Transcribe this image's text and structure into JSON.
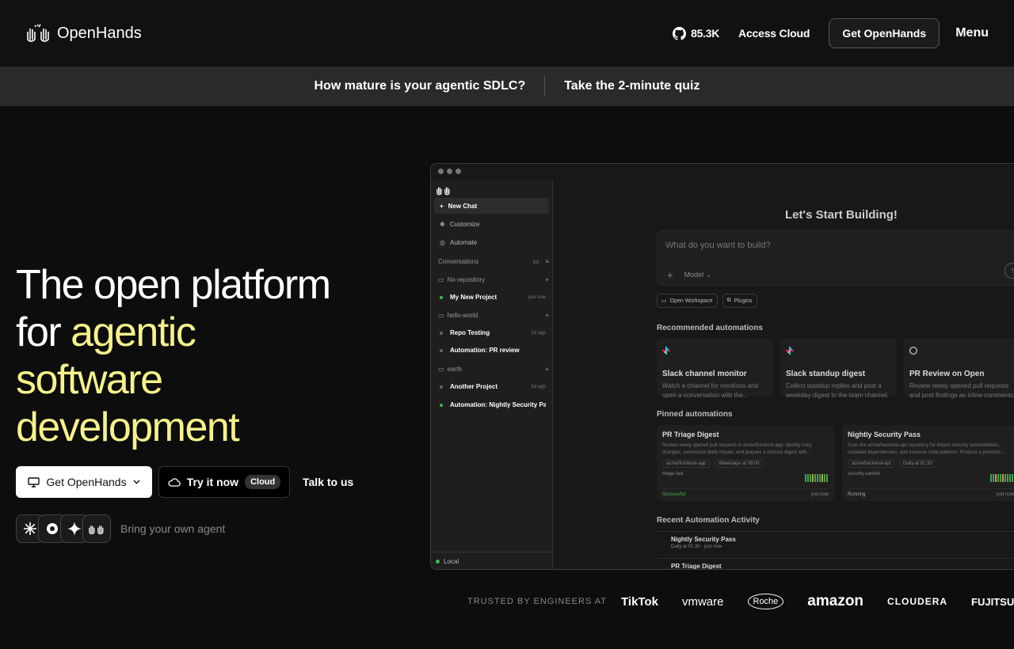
{
  "nav": {
    "brand": "OpenHands",
    "github_stars": "85.3K",
    "access_cloud": "Access Cloud",
    "get_openhands": "Get OpenHands",
    "menu": "Menu"
  },
  "banner": {
    "question": "How mature is your agentic SDLC?",
    "cta": "Take the 2-minute quiz"
  },
  "hero": {
    "title_line1": "The open platform",
    "title_for": "for ",
    "title_hl1": "agentic",
    "title_hl2": "software",
    "title_hl3": "development",
    "cta_primary": "Get OpenHands",
    "cta_secondary": "Try it now",
    "cta_secondary_badge": "Cloud",
    "cta_talk": "Talk to us",
    "byo_agent": "Bring your own agent"
  },
  "app": {
    "sidebar": {
      "new_chat": "New Chat",
      "customize": "Customize",
      "automate": "Automate",
      "conversations_label": "Conversations",
      "groups": [
        {
          "name": "No repository",
          "items": [
            {
              "title": "My New Project",
              "time": "just now",
              "dot": "#3fb950"
            }
          ]
        },
        {
          "name": "hello-world",
          "items": [
            {
              "title": "Repo Testing",
              "time": "2d ago",
              "dot": "#666"
            },
            {
              "title": "Automation: PR review",
              "time": "",
              "dot": "#666"
            }
          ]
        },
        {
          "name": "earth",
          "items": [
            {
              "title": "Another Project",
              "time": "5d ago",
              "dot": "#666"
            },
            {
              "title": "Automation: Nightly Security Pa...",
              "time": "",
              "dot": "#3fb950"
            }
          ]
        }
      ],
      "footer": "Local"
    },
    "main": {
      "title": "Let's Start Building!",
      "prompt_placeholder": "What do you want to build?",
      "model_label": "Model",
      "chip_workspace": "Open Workspace",
      "chip_plugins": "Plugins",
      "recommended_label": "Recommended automations",
      "recommended": [
        {
          "title": "Slack channel monitor",
          "desc": "Watch a channel for mentions and open a conversation with the..."
        },
        {
          "title": "Slack standup digest",
          "desc": "Collect standup replies and post a weekday digest to the team channel."
        },
        {
          "title": "PR Review on Open",
          "desc": "Review newly opened pull requests and post findings as inline comments"
        }
      ],
      "pinned_label": "Pinned automations",
      "pinned": [
        {
          "title": "PR Triage Digest",
          "desc": "Review newly opened pull requests in acme/frontend-app, identify risky changes, summarize likely impact, and prepare a concise digest with...",
          "repo": "acme/frontend-app",
          "schedule": "Weekdays at 09:00",
          "tag": "triage-fast",
          "status": "Successful",
          "status_color": "#3fb950",
          "time": "just now"
        },
        {
          "title": "Nightly Security Pass",
          "desc": "Scan the acme/backend-api repository for known security vulnerabilities, outdated dependencies, and insecure code patterns. Produce a prioritize...",
          "repo": "acme/backend-api",
          "schedule": "Daily at 01:30",
          "tag": "security-careful",
          "status": "Running",
          "status_color": "#aaaaaa",
          "time": "just now"
        }
      ],
      "activity_label": "Recent Automation Activity",
      "activity": [
        {
          "title": "Nightly Security Pass",
          "desc": "Daily at 01:30 · just now"
        },
        {
          "title": "PR Triage Digest",
          "desc": ""
        }
      ]
    }
  },
  "trusted": {
    "label": "TRUSTED BY ENGINEERS AT",
    "brands": [
      "TikTok",
      "vmware",
      "Roche",
      "amazon",
      "CLOUDERA",
      "FUJITSU"
    ]
  },
  "colors": {
    "accent": "#f6f28a",
    "bg": "#0d0d0d",
    "nav": "#111111",
    "banner": "#2a2a2a"
  }
}
